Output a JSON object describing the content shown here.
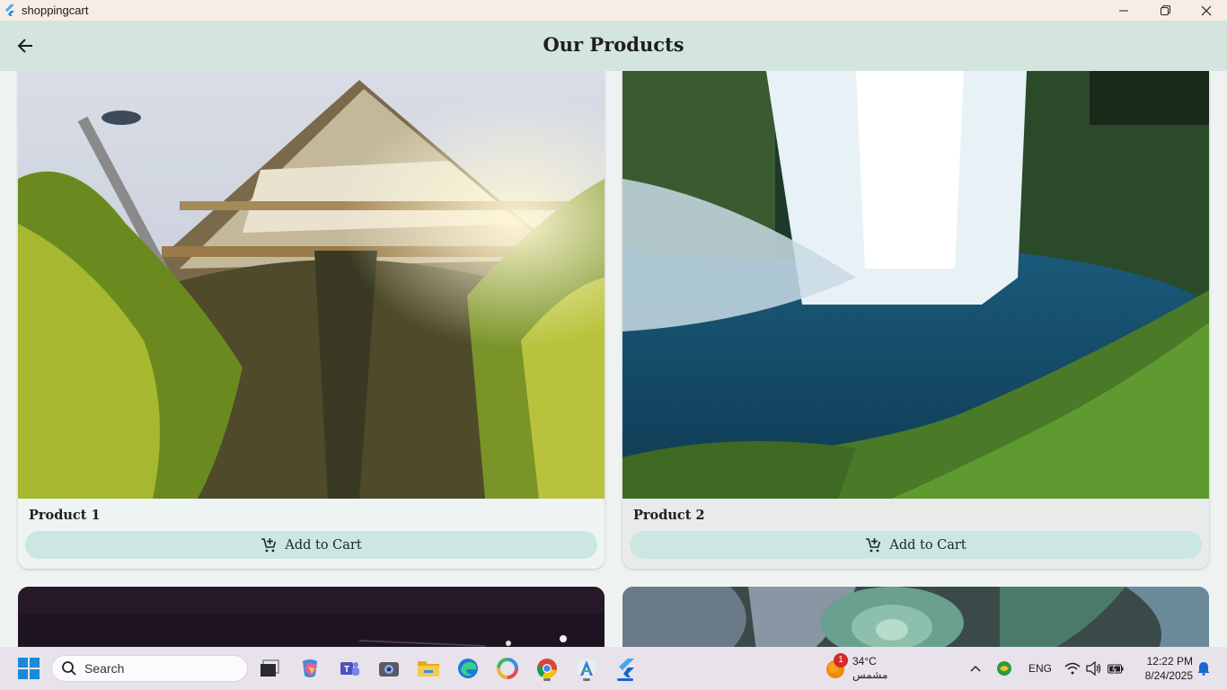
{
  "window": {
    "title": "shoppingcart"
  },
  "appbar": {
    "title": "Our Products"
  },
  "products": [
    {
      "name": "Product 1",
      "button_label": "Add to Cart"
    },
    {
      "name": "Product 2",
      "button_label": "Add to Cart"
    }
  ],
  "taskbar": {
    "search_placeholder": "Search",
    "weather": {
      "temp": "34°C",
      "condition": "مشمس",
      "badge": "1"
    },
    "language": "ENG",
    "time": "12:22 PM",
    "date": "8/24/2025"
  },
  "colors": {
    "appbar": "#d4e4df",
    "button": "#cce6e1",
    "background": "#eef3f1"
  }
}
